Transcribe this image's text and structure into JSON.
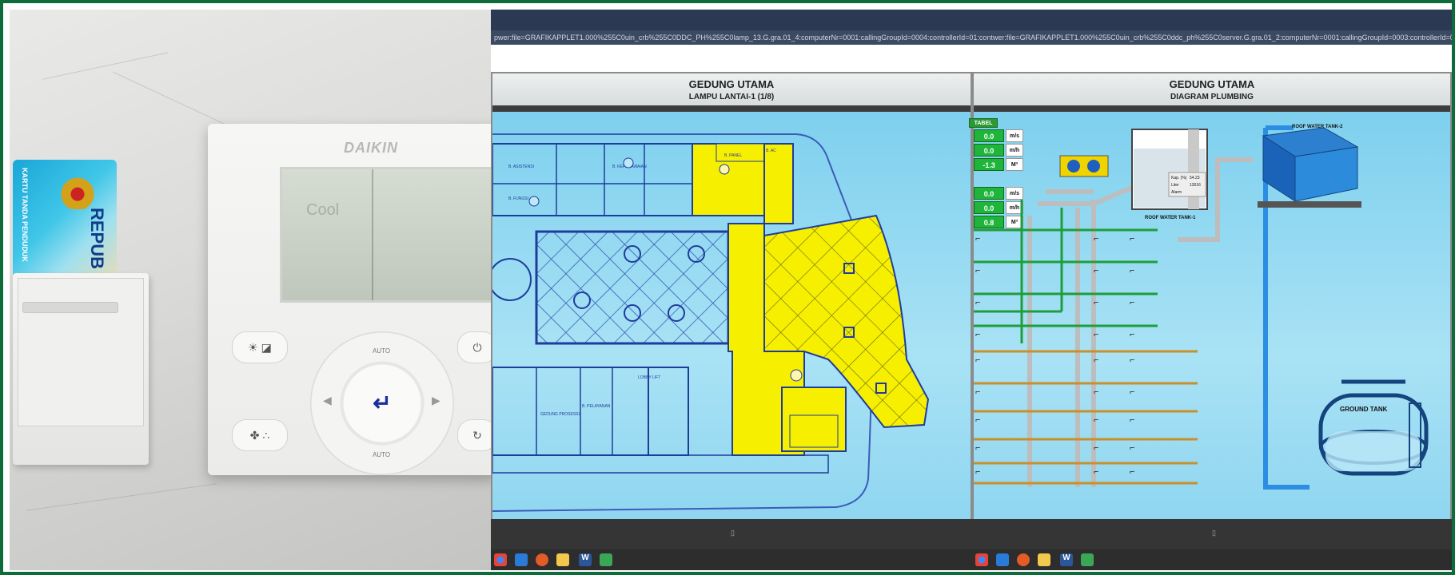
{
  "left_photo": {
    "card_text": "KARTU TANDA PENDUDUK",
    "card_big": "REPUB",
    "remote_brand": "DAIKIN",
    "lcd_faint": "Cool",
    "enter_glyph": "↵",
    "btn_auto_top": "AUTO",
    "btn_auto_bottom": "AUTO"
  },
  "screen": {
    "url": "pwer:file=GRAFIKAPPLET1.000%255C0uin_crb%255C0DDC_PH%255C0lamp_13.G.gra.01_4:computerNr=0001:callingGroupId=0004:controllerId=01:contwer:file=GRAFIKAPPLET1.000%255C0uin_crb%255C0ddc_ph%255C0server.G.gra.01_2:computerNr=0001:callingGroupId=0003:controllerId=01:contro",
    "left_pane": {
      "title": "GEDUNG UTAMA",
      "subtitle": "LAMPU LANTAI-1 (1/8)",
      "rooms": [
        "B. ASISTENSI",
        "B. KEPEGAWAIAN",
        "B. FUNGSI",
        "LOBBY LIFT",
        "GEDUNG PROSESSI",
        "B. PELAYANAN",
        "B. PANEL",
        "B. AC"
      ]
    },
    "right_pane": {
      "title": "GEDUNG UTAMA",
      "subtitle": "DIAGRAM PLUMBING",
      "tabel": "TABEL",
      "meters": [
        {
          "value": "0.0",
          "unit": "m/s"
        },
        {
          "value": "0.0",
          "unit": "m/h"
        },
        {
          "value": "-1.3",
          "unit": "M³"
        },
        {
          "value": "0.0",
          "unit": "m/s"
        },
        {
          "value": "0.0",
          "unit": "m/h"
        },
        {
          "value": "0.8",
          "unit": "M³"
        }
      ],
      "tank1_label": "ROOF WATER TANK-1",
      "tank2_label": "ROOF WATER TANK-2",
      "ground_tank": "GROUND TANK",
      "tank_readout": [
        {
          "label": "Kap. (%)",
          "value": "54.23"
        },
        {
          "label": "Liter",
          "value": "13016"
        },
        {
          "label": "Alarm",
          "value": ""
        }
      ]
    },
    "status_marker": "▯",
    "colors": {
      "highlight": "#f5f200",
      "plan_blue": "#2848a8",
      "bg_blue": "#7fd1ee",
      "pipe_green": "#1e9e3b",
      "pipe_grey": "#bcbcbc",
      "pipe_orange": "#c8902c"
    }
  }
}
